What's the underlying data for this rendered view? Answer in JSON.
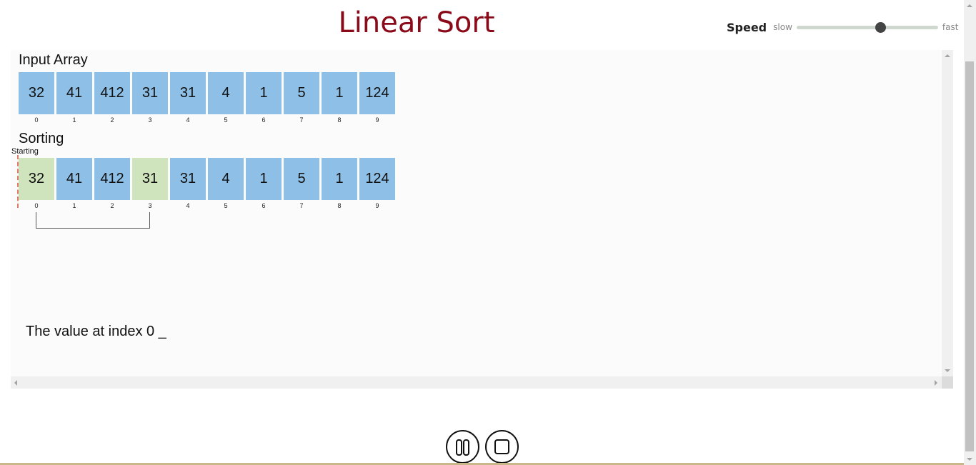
{
  "header": {
    "title": "Linear Sort",
    "speed_label": "Speed",
    "speed_slow": "slow",
    "speed_fast": "fast",
    "speed_value": 0.59
  },
  "visualizer": {
    "input_label": "Input Array",
    "input_values": [
      "32",
      "41",
      "412",
      "31",
      "31",
      "4",
      "1",
      "5",
      "1",
      "124"
    ],
    "sorting_label": "Sorting",
    "sorting_values": [
      "32",
      "41",
      "412",
      "31",
      "31",
      "4",
      "1",
      "5",
      "1",
      "124"
    ],
    "indices": [
      "0",
      "1",
      "2",
      "3",
      "4",
      "5",
      "6",
      "7",
      "8",
      "9"
    ],
    "highlighted_indices": [
      0,
      3
    ],
    "pointer_label": "Starting",
    "pointer_index": 0,
    "status_text": "The value at index 0 _"
  },
  "colors": {
    "title": "#8b0a1a",
    "cell_default": "#8ebfe7",
    "cell_highlight": "#cfe4bd",
    "pointer": "#e07b6a"
  },
  "icons": {
    "pause": "pause-icon",
    "stop": "stop-icon"
  }
}
